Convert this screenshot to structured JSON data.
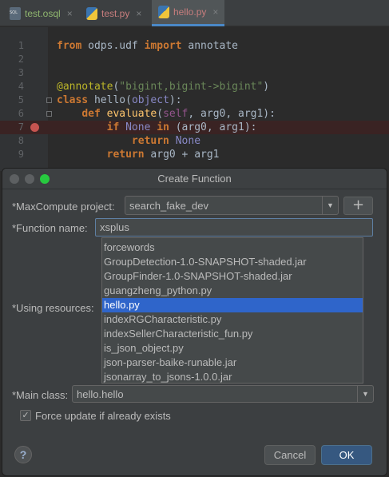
{
  "tabs": [
    {
      "label": "test.osql",
      "icon": "sql-file-icon",
      "color": "#8fb66e"
    },
    {
      "label": "test.py",
      "icon": "python-file-icon",
      "color": "#c77d7d"
    },
    {
      "label": "hello.py",
      "icon": "python-file-icon",
      "color": "#c77d7d",
      "active": true
    }
  ],
  "close_glyph": "×",
  "code_lines": [
    {
      "num": "1",
      "tokens": [
        [
          "kw",
          "from"
        ],
        [
          "",
          " odps.udf "
        ],
        [
          "kw",
          "import"
        ],
        [
          "",
          " annotate"
        ]
      ]
    },
    {
      "num": "2",
      "tokens": []
    },
    {
      "num": "3",
      "tokens": []
    },
    {
      "num": "4",
      "tokens": [
        [
          "deco",
          "@annotate"
        ],
        [
          "",
          "("
        ],
        [
          "str",
          "\"bigint,bigint->bigint\""
        ],
        [
          "",
          ")"
        ]
      ]
    },
    {
      "num": "5",
      "tokens": [
        [
          "kw",
          "class"
        ],
        [
          "",
          " "
        ],
        [
          "",
          "hello"
        ],
        [
          "",
          "("
        ],
        [
          "bi",
          "object"
        ],
        [
          "",
          "):"
        ]
      ]
    },
    {
      "num": "6",
      "tokens": [
        [
          "",
          "    "
        ],
        [
          "kw",
          "def"
        ],
        [
          "",
          " "
        ],
        [
          "fn",
          "evaluate"
        ],
        [
          "",
          "("
        ],
        [
          "self",
          "self"
        ],
        [
          "",
          ", arg0, arg1):"
        ]
      ]
    },
    {
      "num": "7",
      "tokens": [
        [
          "",
          "        "
        ],
        [
          "kw",
          "if"
        ],
        [
          "",
          " "
        ],
        [
          "bi",
          "None"
        ],
        [
          "",
          " "
        ],
        [
          "kw",
          "in"
        ],
        [
          "",
          " (arg0, arg1):"
        ]
      ],
      "error": true
    },
    {
      "num": "8",
      "tokens": [
        [
          "",
          "            "
        ],
        [
          "kw",
          "return"
        ],
        [
          "",
          " "
        ],
        [
          "bi",
          "None"
        ]
      ]
    },
    {
      "num": "9",
      "tokens": [
        [
          "",
          "        "
        ],
        [
          "kw",
          "return"
        ],
        [
          "",
          " arg0 + arg1"
        ]
      ]
    }
  ],
  "dialog": {
    "title": "Create Function",
    "project_label": "*MaxCompute project:",
    "project_value": "search_fake_dev",
    "plus_label": "+",
    "function_label": "*Function name:",
    "function_value": "xsplus",
    "resources_label": "*Using resources:",
    "resources": [
      "forcewords",
      "GroupDetection-1.0-SNAPSHOT-shaded.jar",
      "GroupFinder-1.0-SNAPSHOT-shaded.jar",
      "guangzheng_python.py",
      "hello.py",
      "indexRGCharacteristic.py",
      "indexSellerCharacteristic_fun.py",
      "is_json_object.py",
      "json-parser-baike-runable.jar",
      "jsonarray_to_jsons-1.0.0.jar"
    ],
    "selected_resource": "hello.py",
    "main_class_label": "*Main class:",
    "main_class_value": "hello.hello",
    "force_update_label": "Force update if already exists",
    "force_update_checked": true,
    "help_label": "?",
    "cancel_label": "Cancel",
    "ok_label": "OK"
  }
}
